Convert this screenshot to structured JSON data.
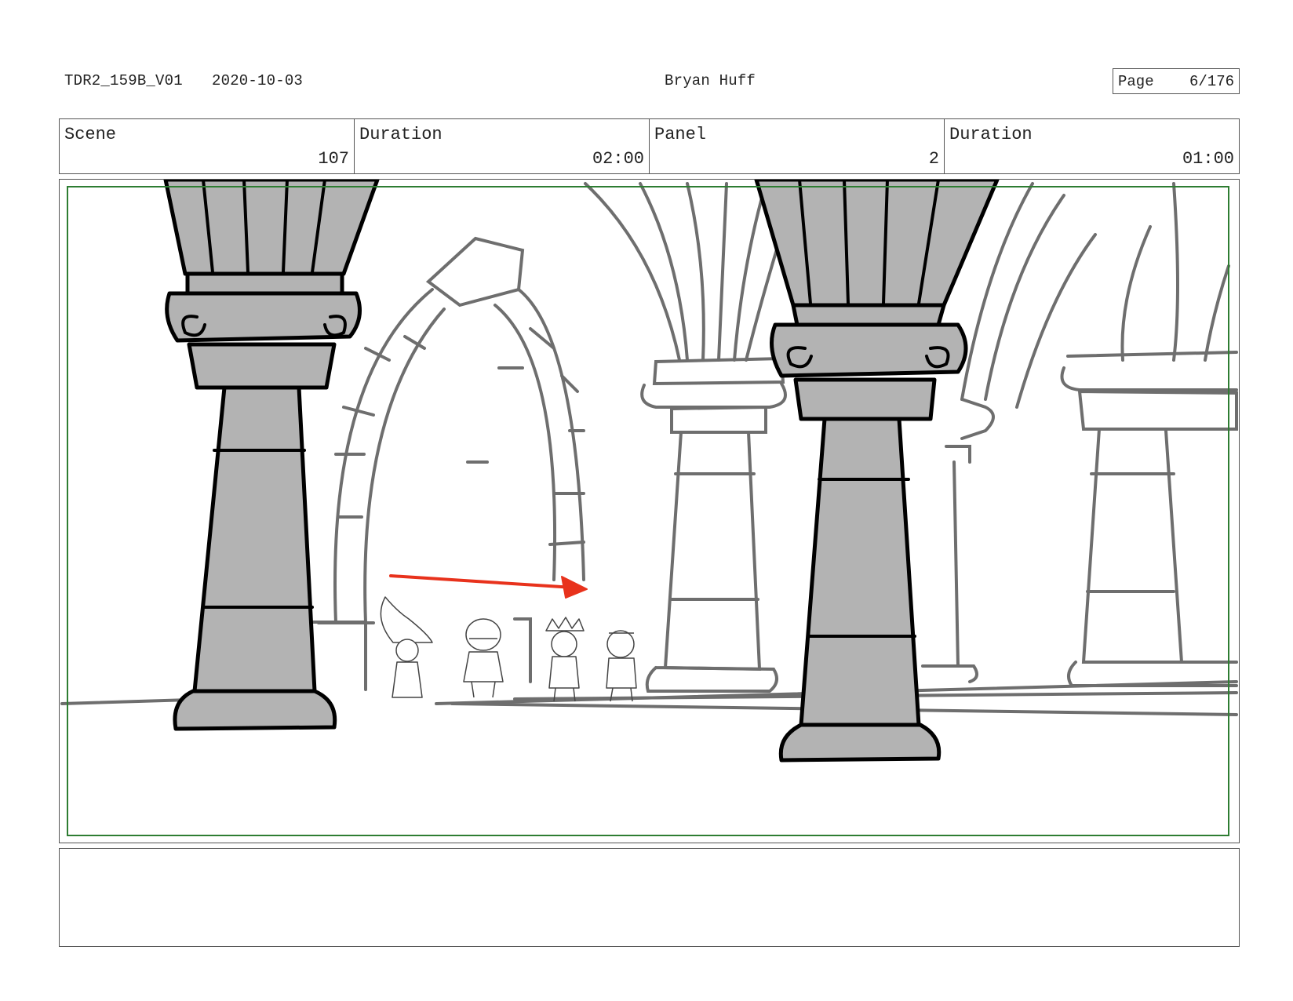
{
  "header": {
    "file_id": "TDR2_159B_V01",
    "date": "2020-10-03",
    "artist": "Bryan Huff",
    "page_label": "Page",
    "page_value": "6/176"
  },
  "info": {
    "scene_label": "Scene",
    "scene_value": "107",
    "scene_duration_label": "Duration",
    "scene_duration_value": "02:00",
    "panel_label": "Panel",
    "panel_value": "2",
    "panel_duration_label": "Duration",
    "panel_duration_value": "01:00"
  },
  "panel": {
    "safe_frame_color": "#2e7d32",
    "arrow_color": "#e8321c",
    "column_fill": "#b3b3b3",
    "sketch_line_color": "#6e6e6e"
  },
  "notes": {
    "text": ""
  }
}
